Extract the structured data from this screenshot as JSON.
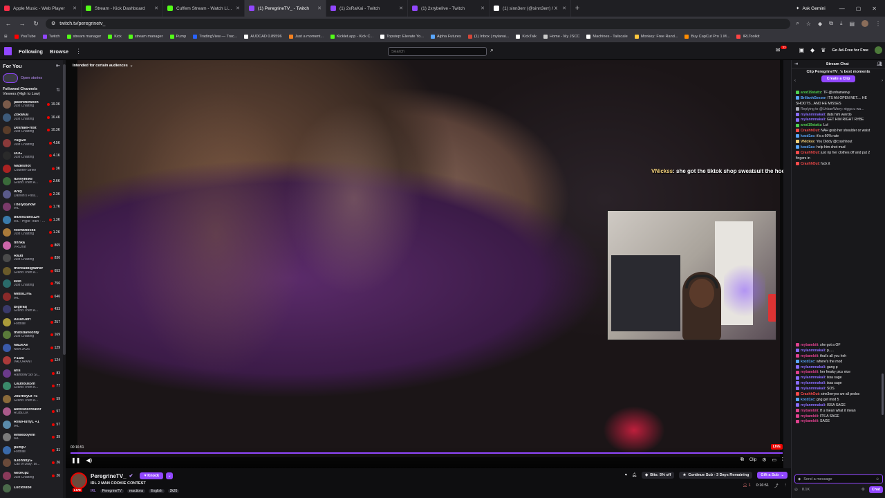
{
  "browser": {
    "tabs": [
      {
        "label": "Apple Music - Web Player",
        "color": "#fa2d48"
      },
      {
        "label": "Stream - Kick Dashboard",
        "color": "#53fc18"
      },
      {
        "label": "Cuffem Stream - Watch Live on",
        "color": "#53fc18"
      },
      {
        "label": "(1) PeregrineTV_ - Twitch",
        "color": "#9147ff"
      },
      {
        "label": "(1) 2xRaKai - Twitch",
        "color": "#9147ff"
      },
      {
        "label": "(1) 2xrybelive - Twitch",
        "color": "#9147ff"
      },
      {
        "label": "(1) sinn3err (@sinn3err) / X",
        "color": "#ffffff"
      }
    ],
    "new_tab": "+",
    "gemini_label": "Ask Gemini",
    "url": "twitch.tv/peregrinetv_",
    "bookmarks": [
      {
        "label": "YouTube",
        "color": "#ff0000"
      },
      {
        "label": "Twitch",
        "color": "#9147ff"
      },
      {
        "label": "stream manager",
        "color": "#53fc18"
      },
      {
        "label": "Kick",
        "color": "#53fc18"
      },
      {
        "label": "stream manager",
        "color": "#53fc18"
      },
      {
        "label": "Pump",
        "color": "#53fc18"
      },
      {
        "label": "TradingView — Trac...",
        "color": "#2962ff"
      },
      {
        "label": "AUDCAD 0.89596",
        "color": "#ffffff"
      },
      {
        "label": "Just a moment...",
        "color": "#f48120"
      },
      {
        "label": "Kicklet.app - Kick C...",
        "color": "#53fc18"
      },
      {
        "label": "Topstep: Elevate Yo...",
        "color": "#ffffff"
      },
      {
        "label": "Alpha Futures",
        "color": "#5aa7ff"
      },
      {
        "label": "(1) Inbox | mylanai...",
        "color": "#d44638"
      },
      {
        "label": "KickTalk",
        "color": "#ffffff"
      },
      {
        "label": "Home - My JSCC",
        "color": "#cccccc"
      },
      {
        "label": "Machines - Tailscale",
        "color": "#ffffff"
      },
      {
        "label": "Monkey: Free Rand...",
        "color": "#ffc83d"
      },
      {
        "label": "Buy CapCut Pro 1 M...",
        "color": "#ff8c00"
      },
      {
        "label": "IRLToolkit",
        "color": "#ff4444"
      }
    ]
  },
  "twitch": {
    "nav": {
      "following": "Following",
      "browse": "Browse",
      "more": "⋮"
    },
    "search_placeholder": "Search",
    "ad_free": "Go Ad-Free for Free",
    "notif_count": "33"
  },
  "sidebar": {
    "for_you": "For You",
    "open_stories": "Open stories",
    "followed_title": "Followed Channels",
    "followed_sort": "Viewers (High to Low)",
    "channels": [
      {
        "name": "jasontheween",
        "game": "Just Chatting",
        "viewers": "19.3K",
        "color": "#7a5a4a"
      },
      {
        "name": "2xRaKai",
        "game": "Just Chatting",
        "viewers": "16.4K",
        "color": "#3d5a7a"
      },
      {
        "name": "DeshaeFrost",
        "game": "Just Chatting",
        "viewers": "10.3K",
        "color": "#5a3d2a"
      },
      {
        "name": "Yugi2x",
        "game": "Just Chatting",
        "viewers": "4.5K",
        "color": "#8a3a3a"
      },
      {
        "name": "DDG",
        "game": "Just Chatting",
        "viewers": "4.1K",
        "color": "#2a2a2a"
      },
      {
        "name": "Nadeshot",
        "game": "Counter-Strike",
        "viewers": "3K",
        "color": "#aa2222"
      },
      {
        "name": "funnymike",
        "game": "Grand Theft A...",
        "viewers": "2.6K",
        "color": "#3a6a3a"
      },
      {
        "name": "Arky",
        "game": "Darwin's Para...",
        "viewers": "2.3K",
        "color": "#5a5a8a"
      },
      {
        "name": "TheIy8Show",
        "game": "IRL",
        "viewers": "1.7K",
        "color": "#7a3a6a"
      },
      {
        "name": "bluesclues124",
        "game": "IRL · Hype Train · Level 3",
        "viewers": "1.3K",
        "color": "#3a7aaa"
      },
      {
        "name": "reemknocks",
        "game": "Just Chatting",
        "viewers": "1.2K",
        "color": "#aa7a3a"
      },
      {
        "name": "tinnka",
        "game": "VRChat",
        "viewers": "865",
        "color": "#cc66aa"
      },
      {
        "name": "Raud",
        "game": "Just Chatting",
        "viewers": "836",
        "color": "#4a4a4a"
      },
      {
        "name": "thereallbigfather",
        "game": "Grand Theft A...",
        "viewers": "653",
        "color": "#6a5a2a"
      },
      {
        "name": "kelo",
        "game": "Just Chatting",
        "viewers": "756",
        "color": "#2a6a6a"
      },
      {
        "name": "MetisLIVE",
        "game": "IRL",
        "viewers": "646",
        "color": "#8a2a2a"
      },
      {
        "name": "Bigtraq",
        "game": "Grand Theft A...",
        "viewers": "433",
        "color": "#3a3a6a"
      },
      {
        "name": "AsianJeff",
        "game": "Fortnite",
        "viewers": "257",
        "color": "#aa9a3a"
      },
      {
        "name": "thatsdaveonty",
        "game": "Just Chatting",
        "viewers": "169",
        "color": "#5a7a3a"
      },
      {
        "name": "NaDeXe",
        "game": "NBA 2K26",
        "viewers": "129",
        "color": "#3a5aaa"
      },
      {
        "name": "P1Ski",
        "game": "VALORANT",
        "viewers": "124",
        "color": "#aa3a3a"
      },
      {
        "name": "aris",
        "game": "Rainbow Six Si...",
        "viewers": "83",
        "color": "#6a3a8a"
      },
      {
        "name": "Cautious5m",
        "game": "Grand Theft A...",
        "viewers": "77",
        "color": "#3a8a6a"
      },
      {
        "name": "Journey0z +5",
        "game": "Grand Theft A...",
        "viewers": "59",
        "color": "#8a6a3a"
      },
      {
        "name": "alexisdecreator",
        "game": "ROBLOX",
        "viewers": "57",
        "color": "#aa5a8a"
      },
      {
        "name": "RealFluffy1 +1",
        "game": "IRL",
        "viewers": "57",
        "color": "#5a8aaa"
      },
      {
        "name": "whileboyem",
        "game": "IRL",
        "viewers": "39",
        "color": "#7a7a7a"
      },
      {
        "name": "pump7",
        "game": "Fortnite",
        "viewers": "31",
        "color": "#3a6aaa"
      },
      {
        "name": "oJohnnyG",
        "game": "Call of Duty: Bl...",
        "viewers": "26",
        "color": "#6a4a3a"
      },
      {
        "name": "NeoKipz",
        "game": "Just Chatting",
        "viewers": "26",
        "color": "#8a3a5a"
      },
      {
        "name": "LucidVibe",
        "game": "",
        "viewers": "",
        "color": "#4a6a4a"
      }
    ]
  },
  "video": {
    "audience_label": "Intended for certain audiences",
    "overlay_name": "VNickss",
    "overlay_msg": ": she got the tiktok shop sweatsuit the hoe be wearin",
    "timecode": "00:16:51",
    "progress": 1.0,
    "live": "LIVE",
    "clip_label": "Clip"
  },
  "stream": {
    "channel": "PeregrineTV_",
    "live": "LIVE",
    "follow": "♥ Knock",
    "title": "IRL 2 MAN COOKIE CONTEST",
    "game": "IRL",
    "tags": [
      "PeregrineTV",
      "reactions",
      "English",
      "2k26"
    ],
    "bits": "Bits: 5% off",
    "continue_sub": "Continue Sub - 3 Days Remaining",
    "gift_sub": "Gift a Sub",
    "viewers": "1",
    "uptime": "0:16:51"
  },
  "chat": {
    "header": "Stream Chat",
    "clip_title": "Clip PeregrineTV_'s best moments",
    "create_clip": "Create a Clip",
    "messages_top": [
      {
        "user": "arod19stattz",
        "text": "TF @unbanwavy",
        "color": "#4fd14f"
      },
      {
        "user": "BrillanhGeezer",
        "text": "ITS AN OPEN NET.... HE SHOOTS...AND HE MISSES",
        "color": "#5aa7ff"
      },
      {
        "user": "",
        "text": "Replying to @UnbanWavy: nigga u wa...",
        "color": "#adadb8"
      },
      {
        "user": "mylanmmakali",
        "text": "dats him weirdo",
        "color": "#8a6dff"
      },
      {
        "user": "mylanmmakali",
        "text": "GET HIM RIGHT RYBE",
        "color": "#8a6dff"
      },
      {
        "user": "arod19stattz",
        "text": "Lol",
        "color": "#4fd14f"
      },
      {
        "user": "CrashhOut",
        "text": "NAH grab her shoulder or waist",
        "color": "#ff4b4b"
      },
      {
        "user": "kozd1sc",
        "text": "it's a 60% rate",
        "color": "#5aa7ff"
      },
      {
        "user": "VNickss",
        "text": "You Diddy @crashhout",
        "color": "#f3d17a"
      },
      {
        "user": "kozd1sc",
        "text": "help him shot mud",
        "color": "#5aa7ff"
      },
      {
        "user": "CrashhOut",
        "text": "just rip her clothes off and put 2 fingers in",
        "color": "#ff4b4b"
      },
      {
        "user": "CrashhOut",
        "text": "fuck it",
        "color": "#ff4b4b"
      }
    ],
    "messages_bottom": [
      {
        "user": "mybambiii",
        "text": "she got a OF",
        "color": "#e0418f"
      },
      {
        "user": "mylanmmakali",
        "text": "p.....",
        "color": "#8a6dff"
      },
      {
        "user": "mybambiii",
        "text": "that's all you heh",
        "color": "#e0418f"
      },
      {
        "user": "kozd1sc",
        "text": "where's the mod",
        "color": "#5aa7ff"
      },
      {
        "user": "mylanmmakali",
        "text": "gang p",
        "color": "#8a6dff"
      },
      {
        "user": "mybambiii",
        "text": "her freaky pics nice",
        "color": "#e0418f"
      },
      {
        "user": "mylanmmakali",
        "text": "issa sage",
        "color": "#8a6dff"
      },
      {
        "user": "mylanmmakali",
        "text": "issa sage",
        "color": "#8a6dff"
      },
      {
        "user": "mylanmmakali",
        "text": "SOS",
        "color": "#8a6dff"
      },
      {
        "user": "CrashhOut",
        "text": "sinn3erryes we all pedos",
        "color": "#ff4b4b"
      },
      {
        "user": "kozd1sc",
        "text": "gng get mod 5",
        "color": "#5aa7ff"
      },
      {
        "user": "mylanmmakali",
        "text": "ISSA SAGE",
        "color": "#8a6dff"
      },
      {
        "user": "mybambiii",
        "text": "tf u mean what it mean",
        "color": "#e0418f"
      },
      {
        "user": "mybambiii",
        "text": "ITS A SAGE",
        "color": "#e0418f"
      },
      {
        "user": "mybambiii",
        "text": "SAGE",
        "color": "#e0418f"
      }
    ],
    "input_placeholder": "Send a message",
    "points": "8.1K",
    "chat_button": "Chat"
  }
}
